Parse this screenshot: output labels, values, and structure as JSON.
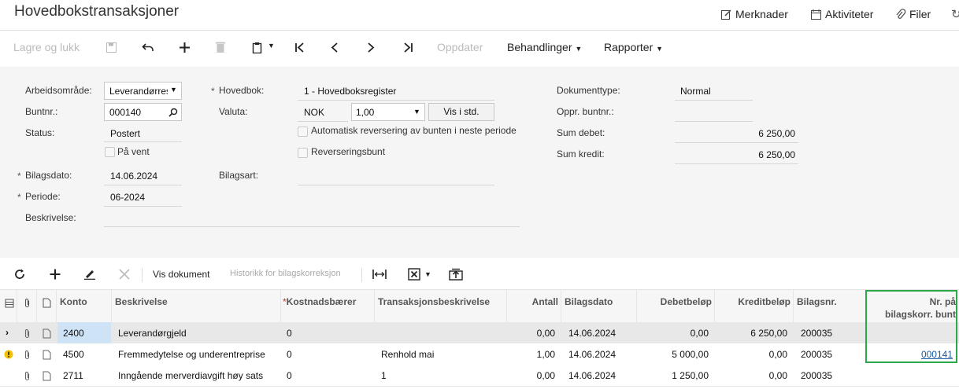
{
  "title": "Hovedbokstransaksjoner",
  "top_links": [
    {
      "label": "Merknader",
      "icon": "note-icon"
    },
    {
      "label": "Aktiviteter",
      "icon": "calendar-icon"
    },
    {
      "label": "Filer",
      "icon": "paperclip-icon"
    }
  ],
  "toolbar": {
    "save_close": "Lagre og lukk",
    "refresh": "Oppdater",
    "actions": "Behandlinger",
    "reports": "Rapporter"
  },
  "form": {
    "workspace_label": "Arbeidsområde:",
    "workspace_value": "Leverandørreskontro",
    "batch_label": "Buntnr.:",
    "batch_value": "000140",
    "status_label": "Status:",
    "status_value": "Postert",
    "hold_label": "På vent",
    "doc_date_label": "Bilagsdato:",
    "doc_date_value": "14.06.2024",
    "period_label": "Periode:",
    "period_value": "06-2024",
    "description_label": "Beskrivelse:",
    "ledger_label": "Hovedbok:",
    "ledger_value": "1 - Hovedboksregister",
    "currency_label": "Valuta:",
    "currency_value": "NOK",
    "rate_value": "1,00",
    "view_base_button": "Vis i std.",
    "auto_reverse_label": "Automatisk reversering av bunten i neste periode",
    "reversing_label": "Reverseringsbunt",
    "doc_class_label": "Bilagsart:",
    "doc_type_label": "Dokumenttype:",
    "doc_type_value": "Normal",
    "orig_batch_label": "Oppr. buntnr.:",
    "sum_debit_label": "Sum debet:",
    "sum_debit_value": "6 250,00",
    "sum_credit_label": "Sum kredit:",
    "sum_credit_value": "6 250,00"
  },
  "grid_toolbar": {
    "view_doc": "Vis dokument",
    "history": "Historikk for bilagskorreksjon"
  },
  "columns": {
    "account": "Konto",
    "description": "Beskrivelse",
    "cost_center": "Kostnadsbærer",
    "trans_desc": "Transaksjonsbeskrivelse",
    "qty": "Antall",
    "doc_date": "Bilagsdato",
    "debit": "Debetbeløp",
    "credit": "Kreditbeløp",
    "doc_no": "Bilagsnr.",
    "corr_batch_1": "Nr. på",
    "corr_batch_2": "bilagskorr. bunt"
  },
  "rows": [
    {
      "account": "2400",
      "description": "Leverandørgjeld",
      "cost_center": "0",
      "trans_desc": "",
      "qty": "0,00",
      "doc_date": "14.06.2024",
      "debit": "0,00",
      "credit": "6 250,00",
      "doc_no": "200035",
      "corr_batch": ""
    },
    {
      "account": "4500",
      "description": "Fremmedytelse og underentreprise",
      "cost_center": "0",
      "trans_desc": "Renhold mai",
      "qty": "1,00",
      "doc_date": "14.06.2024",
      "debit": "5 000,00",
      "credit": "0,00",
      "doc_no": "200035",
      "corr_batch": "000141"
    },
    {
      "account": "2711",
      "description": "Inngående merverdiavgift høy sats",
      "cost_center": "0",
      "trans_desc": "1",
      "qty": "0,00",
      "doc_date": "14.06.2024",
      "debit": "1 250,00",
      "credit": "0,00",
      "doc_no": "200035",
      "corr_batch": ""
    }
  ],
  "colors": {
    "highlight": "#2aa84a",
    "link": "#1a5aa8",
    "selected_cell": "#cfe3f7"
  }
}
